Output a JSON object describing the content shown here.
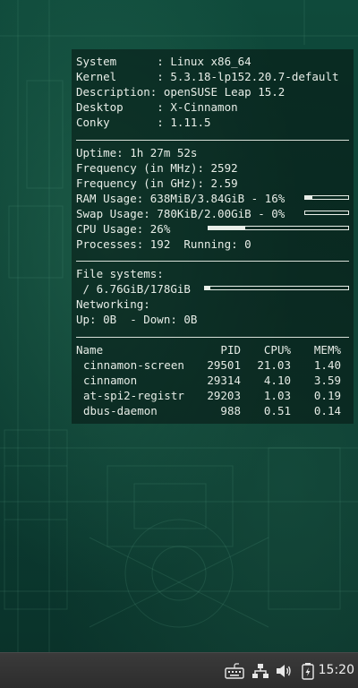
{
  "system": {
    "system_line": "System      : Linux x86_64",
    "kernel_line": "Kernel      : 5.3.18-lp152.20.7-default",
    "description_line": "Description: openSUSE Leap 15.2",
    "desktop_line": "Desktop     : X-Cinnamon",
    "conky_line": "Conky       : 1.11.5"
  },
  "stats": {
    "uptime_line": "Uptime: 1h 27m 52s",
    "freq_mhz_line": "Frequency (in MHz): 2592",
    "freq_ghz_line": "Frequency (in GHz): 2.59",
    "ram_line": "RAM Usage: 638MiB/3.84GiB - 16%",
    "ram_fraction": 0.16,
    "swap_line": "Swap Usage: 780KiB/2.00GiB - 0%",
    "swap_fraction": 0.0,
    "cpu_line": "CPU Usage: 26%",
    "cpu_fraction": 0.26,
    "processes_line": "Processes: 192  Running: 0"
  },
  "filesystems": {
    "header": "File systems:",
    "root_line": " / 6.76GiB/178GiB",
    "root_fraction": 0.04,
    "networking_header": "Networking:",
    "net_line": "Up: 0B  - Down: 0B"
  },
  "processes": {
    "headers": {
      "name": "Name",
      "pid": "PID",
      "cpu": "CPU%",
      "mem": "MEM%"
    },
    "rows": [
      {
        "name": "cinnamon-screen",
        "pid": "29501",
        "cpu": "21.03",
        "mem": "1.40"
      },
      {
        "name": "cinnamon",
        "pid": "29314",
        "cpu": "4.10",
        "mem": "3.59"
      },
      {
        "name": "at-spi2-registr",
        "pid": "29203",
        "cpu": "1.03",
        "mem": "0.19"
      },
      {
        "name": "dbus-daemon",
        "pid": "988",
        "cpu": "0.51",
        "mem": "0.14"
      }
    ]
  },
  "taskbar": {
    "clock": "15:20",
    "icons": [
      "keyboard-icon",
      "network-icon",
      "volume-icon",
      "battery-icon"
    ]
  },
  "colors": {
    "text": "#e8eee8",
    "background": "#0c3f33",
    "panel": "#3a3a3a"
  }
}
